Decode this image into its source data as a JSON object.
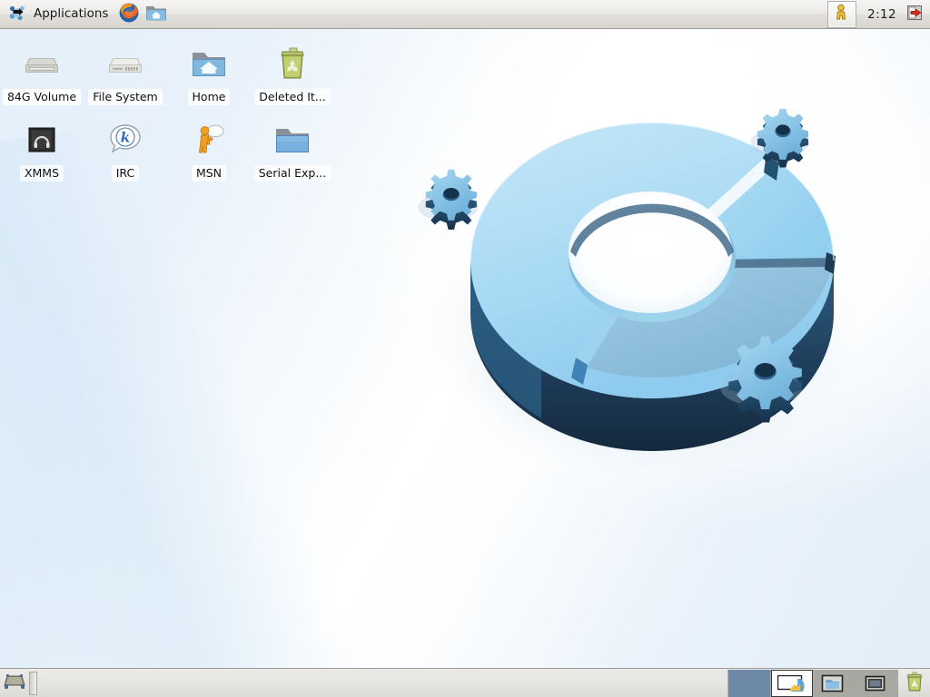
{
  "top_panel": {
    "applications_menu": {
      "icon": "mandriva-star-icon",
      "label": "Applications"
    },
    "launchers": [
      {
        "icon": "firefox-icon",
        "name": "firefox-launcher"
      },
      {
        "icon": "home-folder-icon",
        "name": "file-manager-launcher"
      }
    ],
    "tray": {
      "user_button_icon": "user-person-icon",
      "clock": "2:12",
      "logout_icon": "logout-door-icon"
    }
  },
  "desktop": {
    "rows": [
      [
        {
          "label": "84G Volume",
          "icon": "hard-drive-icon",
          "selected": true
        },
        {
          "label": "File System",
          "icon": "hard-drive-icon",
          "selected": false
        },
        {
          "label": "Home",
          "icon": "home-folder-icon",
          "selected": false
        },
        {
          "label": "Deleted It...",
          "icon": "trash-recycle-icon",
          "selected": false
        }
      ],
      [
        {
          "label": "XMMS",
          "icon": "xmms-headphones-icon",
          "selected": false
        },
        {
          "label": "IRC",
          "icon": "konversation-bubble-icon",
          "selected": false
        },
        {
          "label": "MSN",
          "icon": "amsn-person-icon",
          "selected": false
        },
        {
          "label": "Serial Exp...",
          "icon": "blue-folder-icon",
          "selected": false
        }
      ]
    ]
  },
  "bottom_panel": {
    "show_desktop_icon": "show-desktop-icon",
    "tasklist_items": [],
    "pager": {
      "workspaces": [
        {
          "name": "workspace-1",
          "state": "occupied"
        },
        {
          "name": "workspace-2",
          "state": "active"
        },
        {
          "name": "workspace-3",
          "state": "inactive"
        },
        {
          "name": "workspace-4",
          "state": "inactive"
        }
      ]
    },
    "trash_icon": "trash-recycle-icon"
  },
  "colors": {
    "panel_bg": "#e7e5e1",
    "desktop_bg": "#e9f2fb",
    "accent_blue": "#4f9fd4",
    "workspace_occupied": "#6d89a6",
    "workspace_inactive": "#a8a8a3"
  },
  "wallpaper": {
    "name": "blue-gear-torus-wallpaper",
    "description": "3D light blue segmented torus with three gears"
  }
}
